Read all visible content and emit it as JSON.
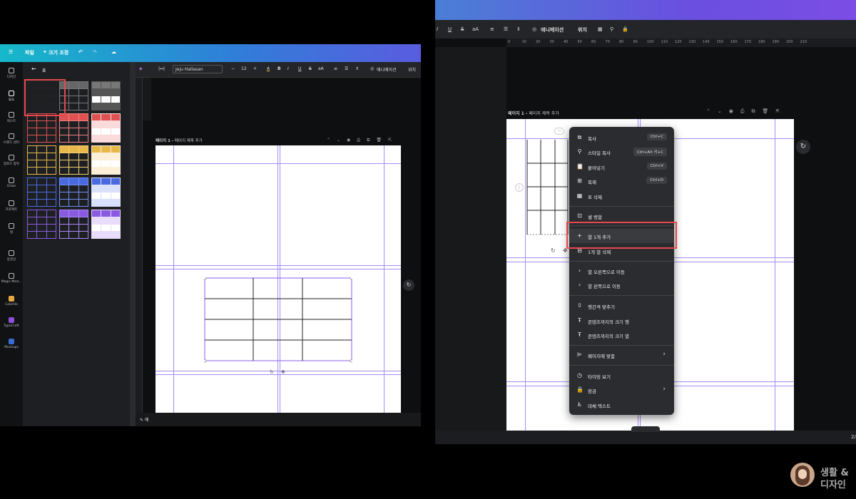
{
  "left": {
    "topbar": {
      "menu": "☰",
      "file": "파일",
      "resize": "크기 조정"
    },
    "rail": [
      "디자인",
      "요소",
      "텍스트",
      "브랜드 센터",
      "업로드 항목",
      "Draw",
      "프로젝트",
      "앱",
      "동영상",
      "Magic Med...",
      "ColorUe",
      "TypeCraft",
      "Mockups"
    ],
    "panel": {
      "back": "←",
      "title": "표"
    },
    "toolbar": {
      "font": "Jeju Hallasan",
      "minus": "−",
      "size": "12",
      "plus": "+",
      "anim": "애니메이션",
      "pos": "위치"
    },
    "page_label": "페이지 1 -",
    "page_title": "페이지 제목 추가",
    "bottom_notes": "메"
  },
  "right": {
    "toolbar": {
      "anim": "애니메이션",
      "pos": "위치"
    },
    "ruler": [
      "0",
      "10",
      "20",
      "30",
      "40",
      "50",
      "60",
      "70",
      "80",
      "90",
      "100",
      "110",
      "120",
      "130",
      "140",
      "150",
      "160",
      "170",
      "180",
      "190",
      "200",
      "210"
    ],
    "page_label": "페이지 1 -",
    "page_title": "페이지 제목 추가",
    "menu": {
      "copy": "복사",
      "copy_sc": "Ctrl+C",
      "style_copy": "스타일 복사",
      "style_copy_sc": "Ctrl+Alt 키+C",
      "paste": "붙여넣기",
      "paste_sc": "Ctrl+V",
      "duplicate": "복제",
      "duplicate_sc": "Ctrl+D",
      "delete_table": "표 삭제",
      "merge": "셀 병합",
      "add_col": "열 1개 추가",
      "delete_col": "1개 열 삭제",
      "move_right": "열 오른쪽으로 이동",
      "move_left": "열 왼쪽으로 이동",
      "fit_rows": "행간격 맞추기",
      "content_rows": "콘텐츠까지의 크기 행",
      "content_cols": "콘텐츠까지의 크기 열",
      "fit_page": "페이지에 맞춤",
      "timing": "타이밍 보기",
      "lock": "잠금",
      "alt_text": "대체 텍스트"
    },
    "page_num": "2/"
  },
  "logo": {
    "line1": "생활 &",
    "line2": "디자인"
  },
  "colors": {
    "highlight": "#e5484d",
    "guide": "#a78bfa"
  }
}
